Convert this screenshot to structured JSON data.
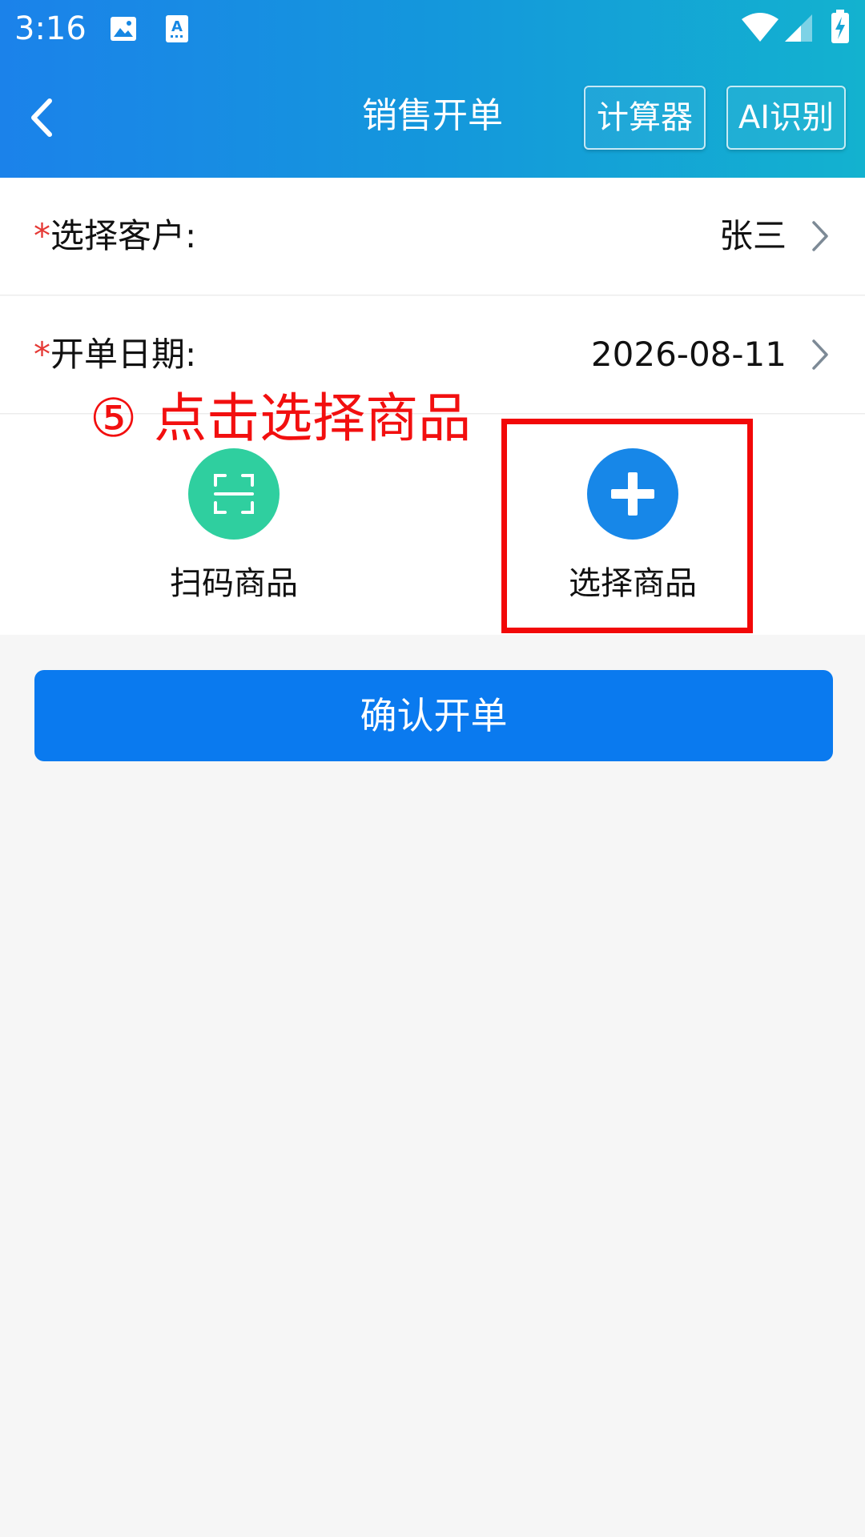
{
  "status_bar": {
    "time": "3:16",
    "icons": [
      "image-icon",
      "text-recognition-icon",
      "wifi-icon",
      "cell-signal-icon",
      "battery-charging-icon"
    ]
  },
  "app_bar": {
    "title": "销售开单",
    "calculator_label": "计算器",
    "ai_label": "AI识别"
  },
  "form": {
    "customer": {
      "required_mark": "*",
      "label": "选择客户:",
      "value": "张三"
    },
    "date": {
      "required_mark": "*",
      "label": "开单日期:",
      "value": "2026-08-11"
    }
  },
  "actions": {
    "scan_label": "扫码商品",
    "select_label": "选择商品"
  },
  "annotation": {
    "text": "⑤ 点击选择商品"
  },
  "confirm_label": "确认开单",
  "colors": {
    "header_start": "#1b82ea",
    "header_end": "#13b2cf",
    "scan_circle": "#2fcf9f",
    "select_circle": "#1787e8",
    "confirm_button": "#0a7aef",
    "required_mark": "#e53935",
    "annotation": "#f20f0f"
  }
}
